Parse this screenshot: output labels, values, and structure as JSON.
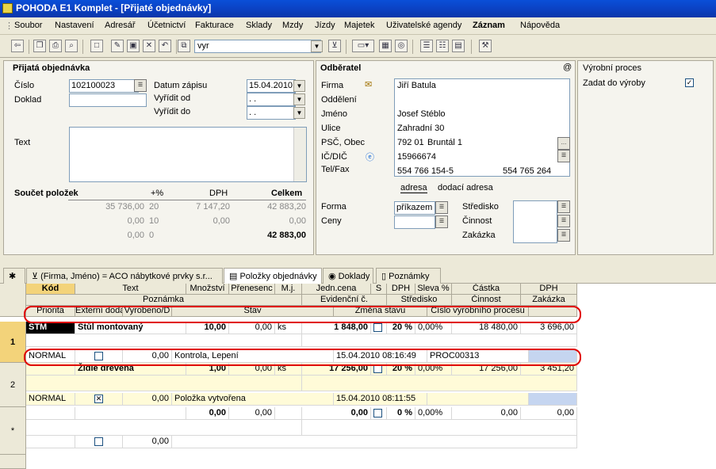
{
  "window": {
    "title": "POHODA E1 Komplet - [Přijaté objednávky]"
  },
  "menu": [
    "Soubor",
    "Nastavení",
    "Adresář",
    "Účetnictví",
    "Fakturace",
    "Sklady",
    "Mzdy",
    "Jízdy",
    "Majetek",
    "Uživatelské agendy",
    "Záznam",
    "Nápověda"
  ],
  "toolbar": {
    "filter_value": "vyr"
  },
  "order": {
    "section_title": "Přijatá objednávka",
    "cislo_label": "Číslo",
    "cislo_value": "102100023",
    "doklad_label": "Doklad",
    "datum_label": "Datum zápisu",
    "datum_value": "15.04.2010",
    "vyridit_od_label": "Vyřídit od",
    "vyridit_od_value": " .  .",
    "vyridit_do_label": "Vyřídit do",
    "vyridit_do_value": " .  .",
    "text_label": "Text",
    "sum_title": "Součet položek",
    "sum_pct": "+%",
    "sum_dph": "DPH",
    "sum_celkem": "Celkem",
    "sum_rows": [
      {
        "base": "35 736,00",
        "pct": "20",
        "dph": "7 147,20",
        "total": "42 883,20"
      },
      {
        "base": "0,00",
        "pct": "10",
        "dph": "0,00",
        "total": "0,00"
      },
      {
        "base": "0,00",
        "pct": "0",
        "dph": "",
        "total": "42 883,00"
      }
    ]
  },
  "partner": {
    "section_title": "Odběratel",
    "firma_label": "Firma",
    "firma_value": "Jiří Batula",
    "oddeleni_label": "Oddělení",
    "jmeno_label": "Jméno",
    "jmeno_value": "Josef Stéblo",
    "ulice_label": "Ulice",
    "ulice_value": "Zahradní 30",
    "psc_label": "PSČ, Obec",
    "psc_value": "792 01",
    "obec_value": "Bruntál 1",
    "ic_label": "IČ/DIČ",
    "ic_value": "15966674",
    "tel_label": "Tel/Fax",
    "tel_value": "554 766 154-5",
    "fax_value": "554 765 264",
    "tab_adresa": "adresa",
    "tab_dodaci": "dodací adresa",
    "forma_label": "Forma",
    "forma_value": "příkazem",
    "ceny_label": "Ceny",
    "stredisko_label": "Středisko",
    "cinnost_label": "Činnost",
    "zakazka_label": "Zakázka"
  },
  "production": {
    "section_title": "Výrobní proces",
    "zadat_label": "Zadat do výroby",
    "zadat_checked": "✓"
  },
  "tabs": [
    "(Firma, Jméno) = ACO nábytkové prvky s.r...",
    "Položky objednávky",
    "Doklady",
    "Poznámky"
  ],
  "grid": {
    "h1": [
      "Kód",
      "Text",
      "Množství",
      "Přenesenc",
      "M.j.",
      "Jedn.cena",
      "S",
      "DPH",
      "Sleva %",
      "Částka",
      "DPH"
    ],
    "h2": [
      "Poznámka",
      "Evidenční č.",
      "Středisko",
      "Činnost",
      "Zakázka"
    ],
    "h3": [
      "Priorita",
      "Externí doda",
      "Vyrobeno/D",
      "Stav",
      "Změna stavu",
      "Číslo výrobního procesu"
    ],
    "rows": [
      {
        "num": "1",
        "kod": "STM",
        "text": "Stůl montovaný",
        "mnozstvi": "10,00",
        "preneseno": "0,00",
        "mj": "ks",
        "cena": "1 848,00",
        "dph": "20 %",
        "sleva": "0,00%",
        "castka": "18 480,00",
        "dphv": "3 696,00",
        "priorita": "NORMAL",
        "vyrobeno": "0,00",
        "stav": "Kontrola, Lepení",
        "zmena": "15.04.2010 08:16:49",
        "proces": "PROC00313",
        "ext": ""
      },
      {
        "num": "2",
        "kod": "",
        "text": "Židle drevena",
        "mnozstvi": "1,00",
        "preneseno": "0,00",
        "mj": "ks",
        "cena": "17 256,00",
        "dph": "20 %",
        "sleva": "0,00%",
        "castka": "17 256,00",
        "dphv": "3 451,20",
        "priorita": "NORMAL",
        "vyrobeno": "0,00",
        "stav": "Položka vytvořena",
        "zmena": "15.04.2010 08:11:55",
        "proces": "",
        "ext": "✕"
      },
      {
        "num": "*",
        "kod": "",
        "text": "",
        "mnozstvi": "0,00",
        "preneseno": "0,00",
        "mj": "",
        "cena": "0,00",
        "dph": "0 %",
        "sleva": "0,00%",
        "castka": "0,00",
        "dphv": "0,00",
        "priorita": "",
        "vyrobeno": "0,00",
        "stav": "",
        "zmena": "",
        "proces": "",
        "ext": ""
      }
    ]
  },
  "colors": {
    "title_bar": "#0b3fbf",
    "highlight": "#e00000",
    "row_yellow": "#fffbd8"
  }
}
